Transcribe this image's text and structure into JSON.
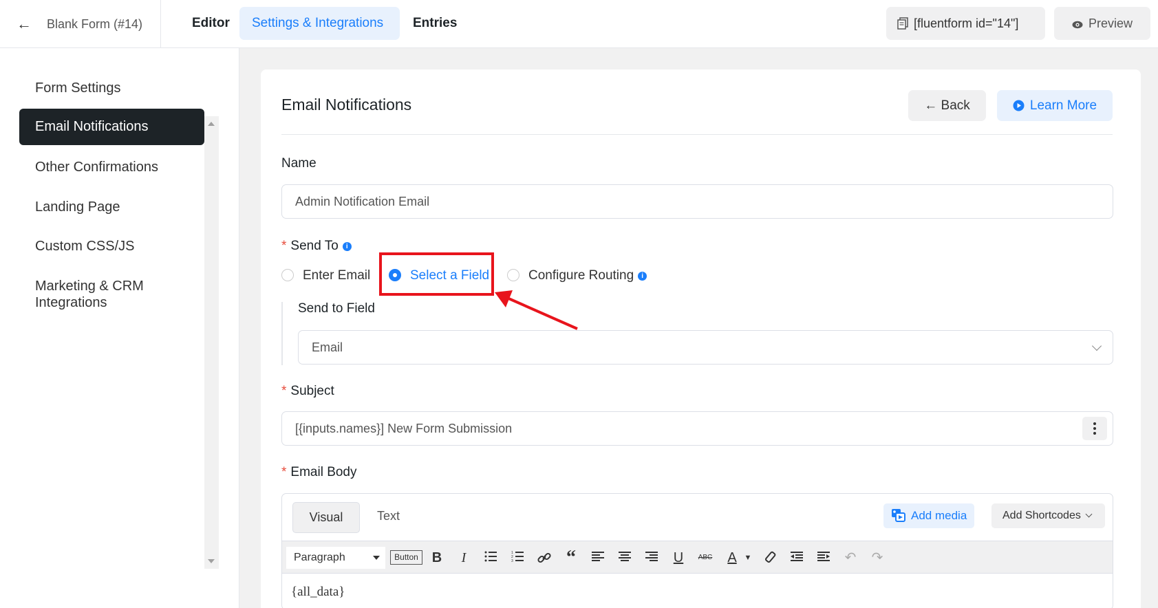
{
  "topbar": {
    "form_title": "Blank Form (#14)",
    "tabs": [
      {
        "label": "Editor"
      },
      {
        "label": "Settings & Integrations"
      },
      {
        "label": "Entries"
      }
    ],
    "shortcode": "[fluentform id=\"14\"]",
    "preview_label": "Preview"
  },
  "sidebar": {
    "items": [
      {
        "label": "Form Settings"
      },
      {
        "label": "Email Notifications"
      },
      {
        "label": "Other Confirmations"
      },
      {
        "label": "Landing Page"
      },
      {
        "label": "Custom CSS/JS"
      },
      {
        "label": "Marketing & CRM Integrations"
      }
    ]
  },
  "main": {
    "title": "Email Notifications",
    "back_label": "Back",
    "learn_more_label": "Learn More",
    "name": {
      "label": "Name",
      "value": "Admin Notification Email"
    },
    "send_to": {
      "label": "Send To",
      "options": [
        {
          "label": "Enter Email"
        },
        {
          "label": "Select a Field"
        },
        {
          "label": "Configure Routing"
        }
      ],
      "selected": "Select a Field"
    },
    "send_to_field": {
      "label": "Send to Field",
      "value": "Email"
    },
    "subject": {
      "label": "Subject",
      "value": "[{inputs.names}] New Form Submission"
    },
    "email_body": {
      "label": "Email Body",
      "visual_tab": "Visual",
      "text_tab": "Text",
      "add_media": "Add media",
      "add_shortcodes": "Add Shortcodes",
      "format_select": "Paragraph",
      "button_tag": "Button",
      "content": "{all_data}"
    }
  },
  "colors": {
    "accent": "#1a7efb",
    "sidebar_active_bg": "#1d2327",
    "annotation_red": "#e8141c",
    "required": "#e74c3c"
  }
}
